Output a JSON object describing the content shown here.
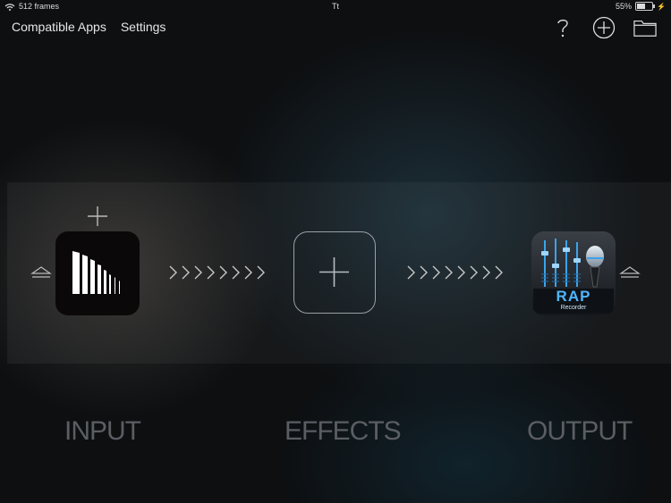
{
  "status_bar": {
    "left_text": "512 frames",
    "center_text": "Tt",
    "battery_percent": "55%",
    "battery_level": 0.55
  },
  "nav": {
    "compatible_apps": "Compatible Apps",
    "settings": "Settings"
  },
  "toolbar": {
    "help_icon": "question-icon",
    "add_icon": "plus-circle-icon",
    "folder_icon": "folder-icon"
  },
  "chain": {
    "input_icon": "audio-level-bars-icon",
    "effects_icon": "plus-icon",
    "output_app": {
      "title": "RAP",
      "subtitle": "Recorder"
    }
  },
  "sections": {
    "input": "INPUT",
    "effects": "EFFECTS",
    "output": "OUTPUT"
  },
  "colors": {
    "accent_blue": "#2a9ee8",
    "label_gray": "#5a5e63"
  }
}
